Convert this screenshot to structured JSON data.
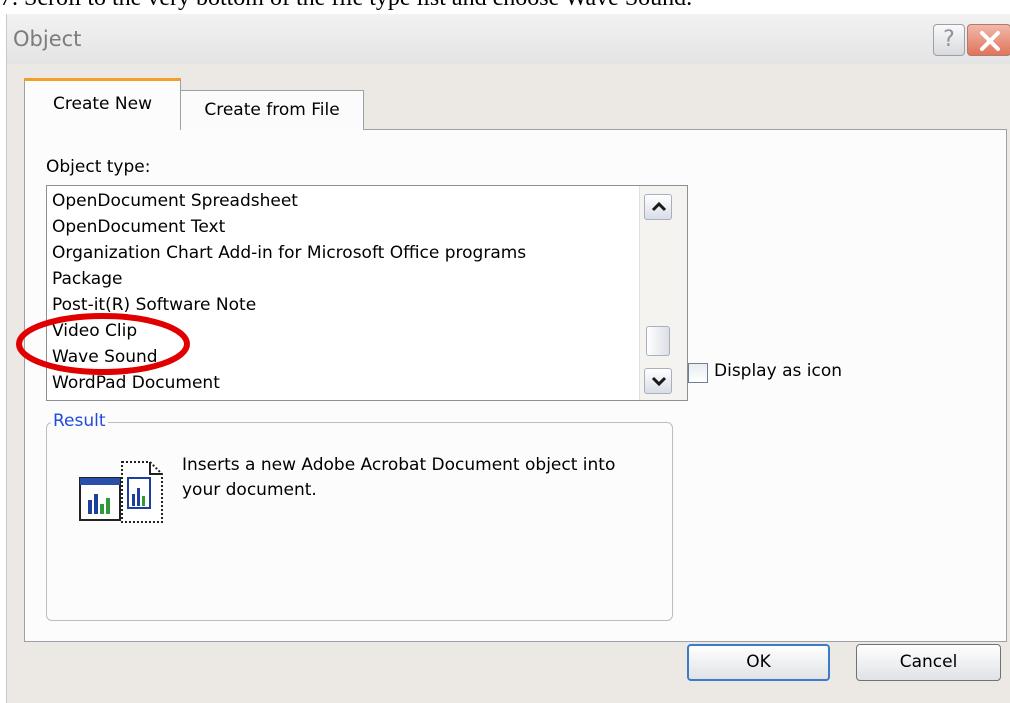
{
  "instruction_text": "7.   Scroll to the very bottom of the file type list and choose Wave Sound.",
  "dialog": {
    "title": "Object",
    "help_label": "?",
    "tabs": [
      {
        "label": "Create New",
        "active": true
      },
      {
        "label": "Create from File",
        "active": false
      }
    ],
    "object_type_label": "Object type:",
    "object_types": [
      "OpenDocument Spreadsheet",
      "OpenDocument Text",
      "Organization Chart Add-in for Microsoft Office programs",
      "Package",
      "Post-it(R) Software Note",
      "Video Clip",
      "Wave Sound",
      "WordPad Document"
    ],
    "display_as_icon_label": "Display as icon",
    "display_as_icon_checked": false,
    "result": {
      "legend": "Result",
      "text": "Inserts a new Adobe Acrobat Document object into your document."
    },
    "ok_label": "OK",
    "cancel_label": "Cancel"
  },
  "annotation": {
    "target": "Wave Sound",
    "color": "#e00000"
  },
  "colors": {
    "active_tab_accent": "#f2a02a",
    "result_legend": "#1f4bd6",
    "close_button": "#e0745c"
  },
  "icons": [
    "help-icon",
    "close-icon",
    "scroll-up-icon",
    "scroll-down-icon",
    "document-object-icon",
    "annotation-ellipse"
  ]
}
